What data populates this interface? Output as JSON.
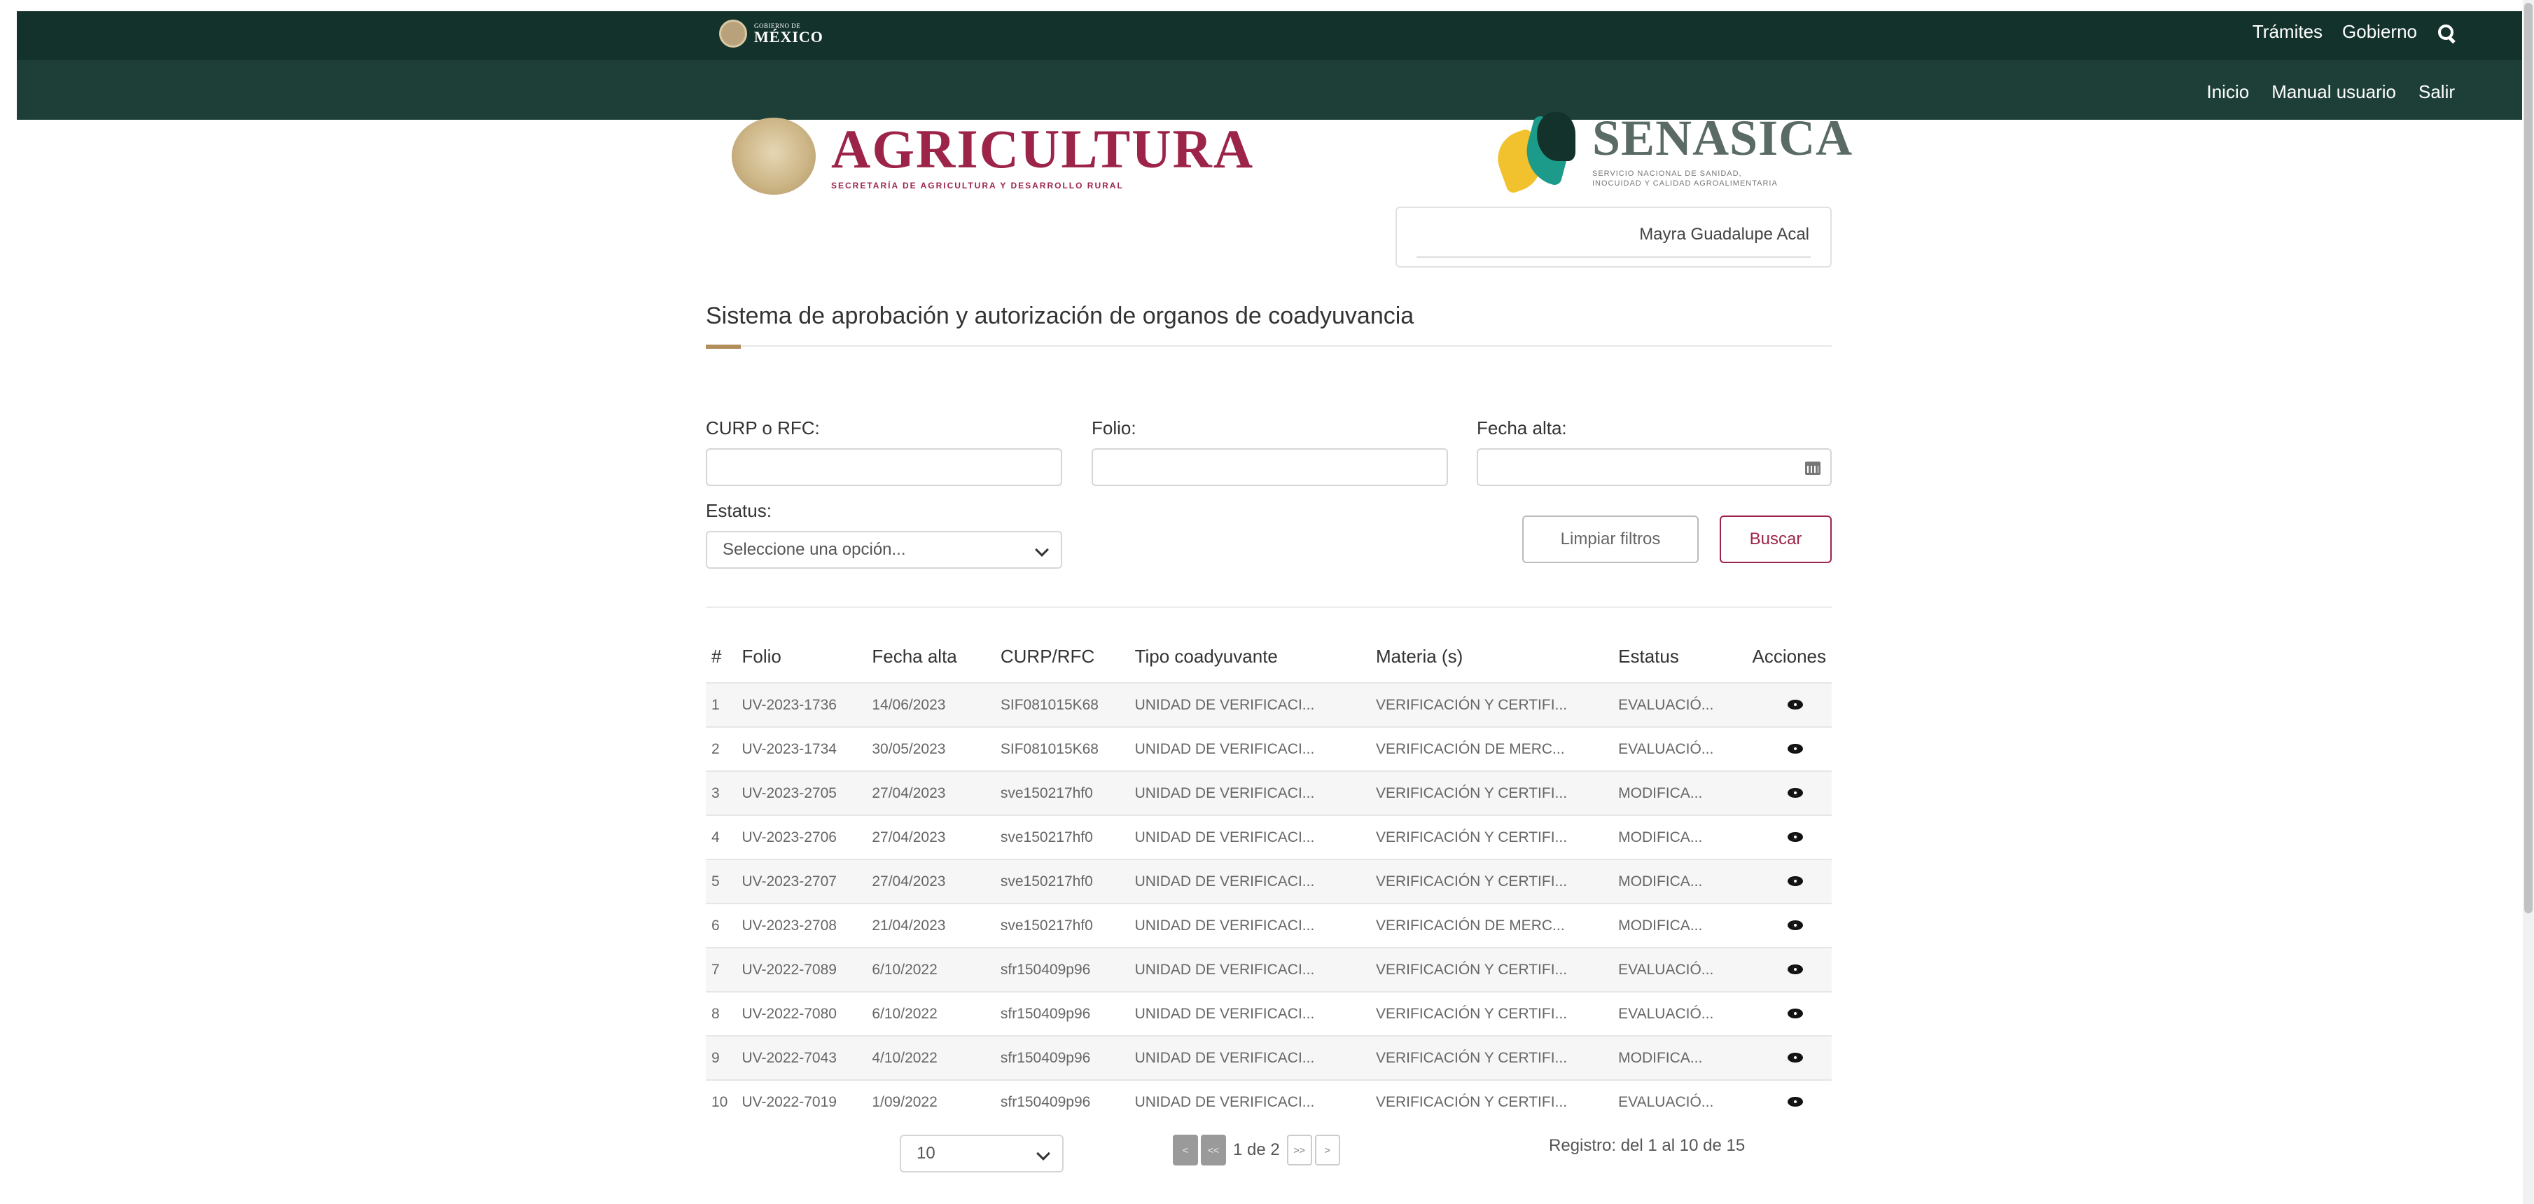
{
  "header": {
    "gob_small": "GOBIERNO DE",
    "gob_big": "MÉXICO",
    "top_links": [
      "Trámites",
      "Gobierno"
    ],
    "sub_links": [
      "Inicio",
      "Manual usuario",
      "Salir"
    ]
  },
  "logos": {
    "agricultura": "AGRICULTURA",
    "agricultura_sub": "SECRETARÍA DE AGRICULTURA Y DESARROLLO RURAL",
    "senasica": "SENASICA",
    "senasica_sub1": "SERVICIO NACIONAL DE SANIDAD,",
    "senasica_sub2": "INOCUIDAD Y CALIDAD AGROALIMENTARIA"
  },
  "user": {
    "name": "Mayra Guadalupe Acal"
  },
  "page": {
    "title": "Sistema de aprobación y autorización de organos de coadyuvancia"
  },
  "filters": {
    "curp_label": "CURP o RFC:",
    "curp_value": "",
    "folio_label": "Folio:",
    "folio_value": "",
    "fecha_label": "Fecha alta:",
    "fecha_value": "",
    "estatus_label": "Estatus:",
    "estatus_selected": "Seleccione una opción...",
    "clear_label": "Limpiar filtros",
    "search_label": "Buscar"
  },
  "table": {
    "headers": [
      "#",
      "Folio",
      "Fecha alta",
      "CURP/RFC",
      "Tipo coadyuvante",
      "Materia (s)",
      "Estatus",
      "Acciones"
    ],
    "rows": [
      [
        "1",
        "UV-2023-1736",
        "14/06/2023",
        "SIF081015K68",
        "UNIDAD DE VERIFICACI...",
        "VERIFICACIÓN Y CERTIFI...",
        "EVALUACIÓ..."
      ],
      [
        "2",
        "UV-2023-1734",
        "30/05/2023",
        "SIF081015K68",
        "UNIDAD DE VERIFICACI...",
        "VERIFICACIÓN DE MERC...",
        "EVALUACIÓ..."
      ],
      [
        "3",
        "UV-2023-2705",
        "27/04/2023",
        "sve150217hf0",
        "UNIDAD DE VERIFICACI...",
        "VERIFICACIÓN Y CERTIFI...",
        "MODIFICA..."
      ],
      [
        "4",
        "UV-2023-2706",
        "27/04/2023",
        "sve150217hf0",
        "UNIDAD DE VERIFICACI...",
        "VERIFICACIÓN Y CERTIFI...",
        "MODIFICA..."
      ],
      [
        "5",
        "UV-2023-2707",
        "27/04/2023",
        "sve150217hf0",
        "UNIDAD DE VERIFICACI...",
        "VERIFICACIÓN Y CERTIFI...",
        "MODIFICA..."
      ],
      [
        "6",
        "UV-2023-2708",
        "21/04/2023",
        "sve150217hf0",
        "UNIDAD DE VERIFICACI...",
        "VERIFICACIÓN DE MERC...",
        "MODIFICA..."
      ],
      [
        "7",
        "UV-2022-7089",
        "6/10/2022",
        "sfr150409p96",
        "UNIDAD DE VERIFICACI...",
        "VERIFICACIÓN Y CERTIFI...",
        "EVALUACIÓ..."
      ],
      [
        "8",
        "UV-2022-7080",
        "6/10/2022",
        "sfr150409p96",
        "UNIDAD DE VERIFICACI...",
        "VERIFICACIÓN Y CERTIFI...",
        "EVALUACIÓ..."
      ],
      [
        "9",
        "UV-2022-7043",
        "4/10/2022",
        "sfr150409p96",
        "UNIDAD DE VERIFICACI...",
        "VERIFICACIÓN Y CERTIFI...",
        "MODIFICA..."
      ],
      [
        "10",
        "UV-2022-7019",
        "1/09/2022",
        "sfr150409p96",
        "UNIDAD DE VERIFICACI...",
        "VERIFICACIÓN Y CERTIFI...",
        "EVALUACIÓ..."
      ]
    ]
  },
  "pagination": {
    "page_size": "10",
    "prev": "<",
    "first": "<<",
    "page_text": "1 de 2",
    "last": ">>",
    "next": ">",
    "registro_text": "Registro: del 1 al 10 de 15"
  }
}
